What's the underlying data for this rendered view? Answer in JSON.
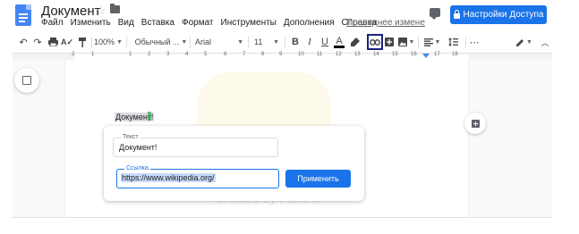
{
  "header": {
    "doc_title": "Документ",
    "icons": {
      "doc": "docs-logo-icon",
      "star": "star-icon",
      "folder": "folder-icon",
      "comments": "comment-icon",
      "share_lock": "lock-icon"
    },
    "menu": [
      "Файл",
      "Изменить",
      "Вид",
      "Вставка",
      "Формат",
      "Инструменты",
      "Дополнения",
      "Справка"
    ],
    "last_edit": "Последнее измене",
    "share_label": "Настройки Доступа",
    "accent_color": "#1a73e8"
  },
  "toolbar": {
    "zoom": "100%",
    "style": "Обычный ...",
    "font": "Arial",
    "font_size": "11",
    "buttons": [
      "undo-icon",
      "redo-icon",
      "print-icon",
      "spellcheck-icon",
      "paint-format-icon",
      "bold-icon",
      "italic-icon",
      "underline-icon",
      "text-color-icon",
      "highlight-icon",
      "link-icon",
      "add-comment-icon",
      "image-icon",
      "align-icon",
      "line-spacing-icon",
      "more-icon",
      "edit-mode-icon",
      "collapse-icon"
    ],
    "bold": "B",
    "italic": "I",
    "underline": "U",
    "text_color": "A",
    "more": "⋯"
  },
  "ruler": {
    "numbers": [
      "2",
      "1",
      "1",
      "2",
      "3",
      "4",
      "5",
      "6",
      "7",
      "8",
      "9",
      "10",
      "11",
      "12",
      "13",
      "14",
      "15",
      "16",
      "17",
      "18"
    ]
  },
  "document": {
    "body_text": "Документ!",
    "watermark": "Created by Paint S"
  },
  "link_dialog": {
    "text_label": "Текст",
    "text_value": "Документ!",
    "link_label": "Ссылка",
    "link_value": "https://www.wikipedia.org/",
    "apply_label": "Применить"
  }
}
